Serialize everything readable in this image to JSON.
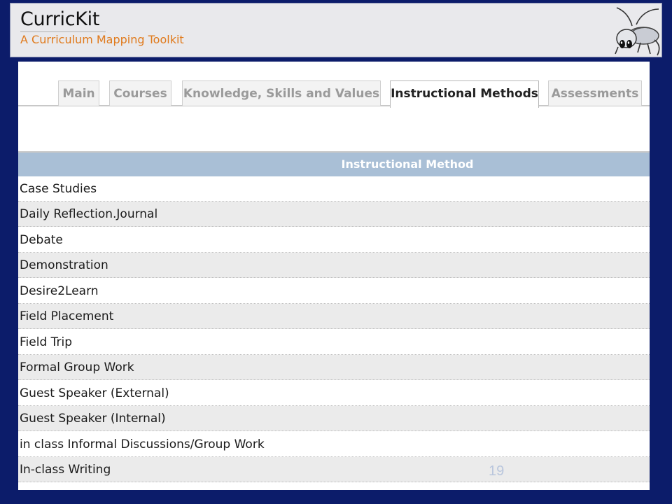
{
  "header": {
    "title": "CurricKit",
    "subtitle": "A Curriculum Mapping Toolkit",
    "logo": "cricket-mascot-logo"
  },
  "tabs": [
    {
      "label": "Main",
      "active": false
    },
    {
      "label": "Courses",
      "active": false
    },
    {
      "label": "Knowledge, Skills and Values",
      "active": false
    },
    {
      "label": "Instructional Methods",
      "active": true
    },
    {
      "label": "Assessments",
      "active": false
    }
  ],
  "table": {
    "header": "Instructional Method",
    "rows": [
      "Case Studies",
      "Daily Reflection.Journal",
      "Debate",
      "Demonstration",
      "Desire2Learn",
      "Field Placement",
      "Field Trip",
      "Formal Group Work",
      "Guest Speaker (External)",
      "Guest Speaker (Internal)",
      "in class Informal Discussions/Group Work",
      "In-class Writing"
    ]
  },
  "page_number": "19",
  "colors": {
    "background": "#0c1c6a",
    "subtitle": "#e07a1c",
    "table_header": "#a9bfd6",
    "row_alt": "#ebebeb"
  }
}
